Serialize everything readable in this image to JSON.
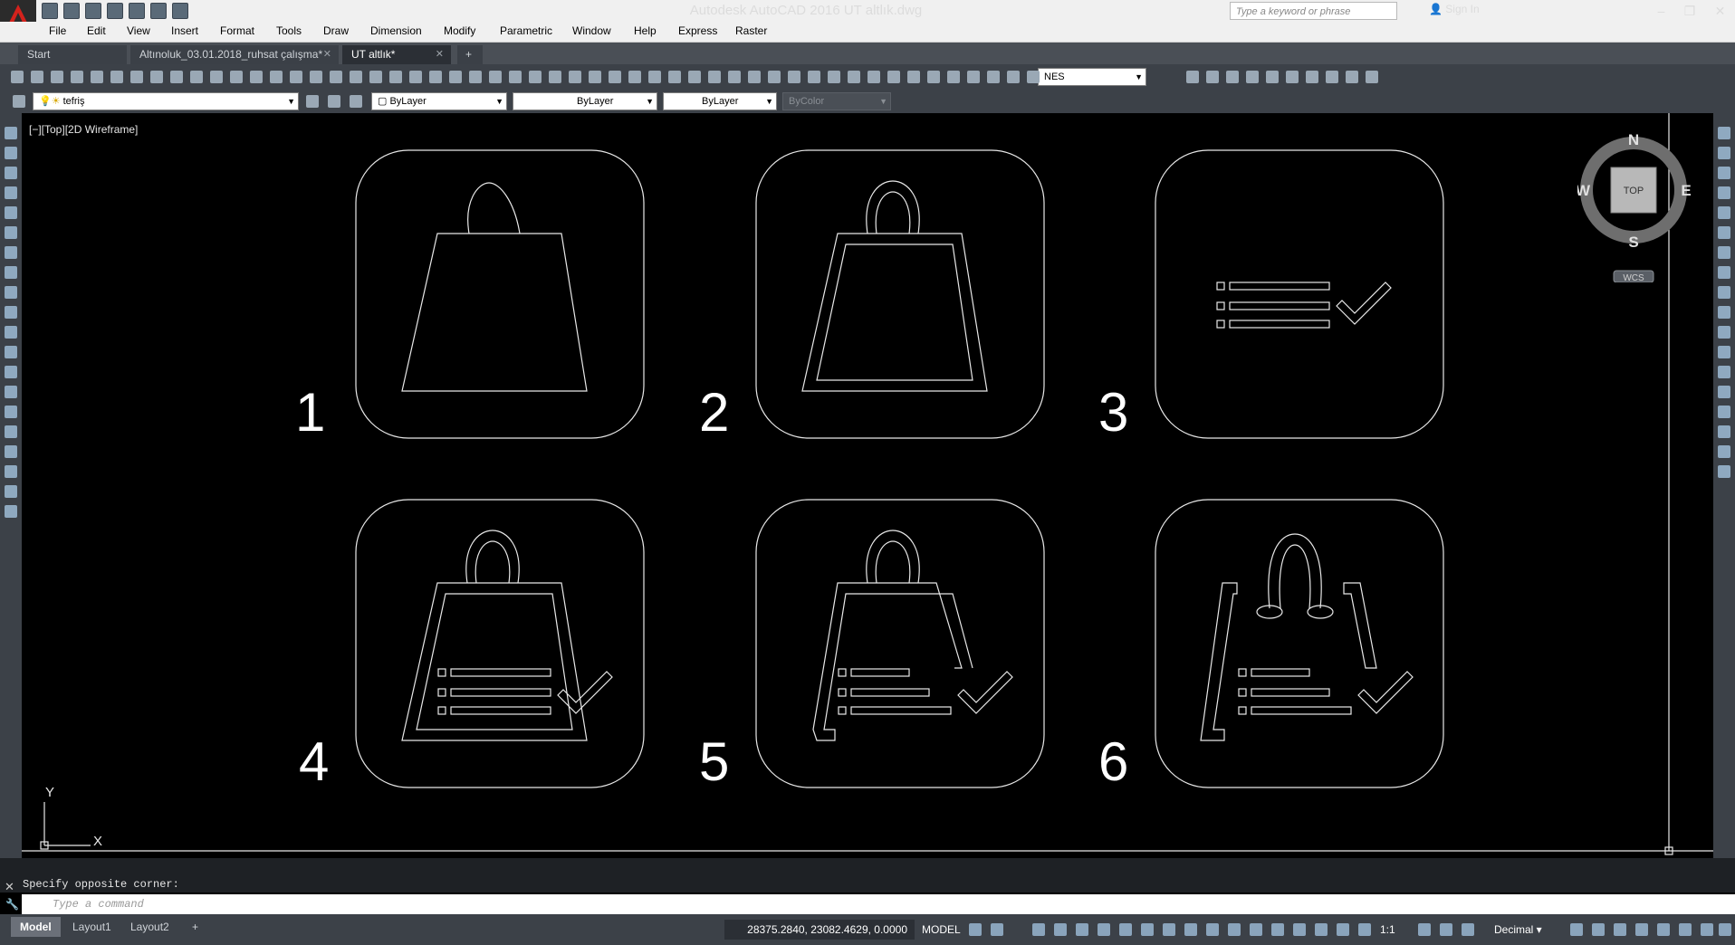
{
  "title_bar": {
    "window_title": "Autodesk AutoCAD 2016    UT altlık.dwg",
    "search_placeholder": "Type a keyword or phrase",
    "sign_in": "Sign In",
    "minimize": "–",
    "restore": "❐",
    "close": "✕"
  },
  "menu": [
    "File",
    "Edit",
    "View",
    "Insert",
    "Format",
    "Tools",
    "Draw",
    "Dimension",
    "Modify",
    "Parametric",
    "Window",
    "Help",
    "Express",
    "Raster"
  ],
  "doc_tabs": [
    {
      "label": "Start",
      "close": ""
    },
    {
      "label": "Altınoluk_03.01.2018_ruhsat çalışma*",
      "close": "✕"
    },
    {
      "label": "UT altlık*",
      "close": "✕"
    }
  ],
  "new_tab": "+",
  "toolbar": {
    "text_style": "NES",
    "layer": "tefriş",
    "color": "ByLayer",
    "linetype": "ByLayer",
    "lineweight": "ByLayer",
    "plot_style": "ByColor"
  },
  "viewport": {
    "label": "[−][Top][2D Wireframe]",
    "viewcube": {
      "north": "N",
      "south": "S",
      "east": "E",
      "west": "W",
      "face": "TOP",
      "wcs": "WCS"
    },
    "ucs": {
      "x": "X",
      "y": "Y"
    }
  },
  "drawing": {
    "numbers": [
      "1",
      "2",
      "3",
      "4",
      "5",
      "6"
    ]
  },
  "command": {
    "history": "Specify opposite corner:",
    "placeholder": "Type a command"
  },
  "status": {
    "layout_tabs": [
      "Model",
      "Layout1",
      "Layout2"
    ],
    "add_layout": "+",
    "coordinates": "28375.2840, 23082.4629, 0.0000",
    "space": "MODEL",
    "scale": "1:1",
    "units": "Decimal"
  },
  "colors": {
    "accent": "#d4221c",
    "panel": "#3c4148",
    "canvas": "#000000",
    "line": "#e8e8e8"
  }
}
